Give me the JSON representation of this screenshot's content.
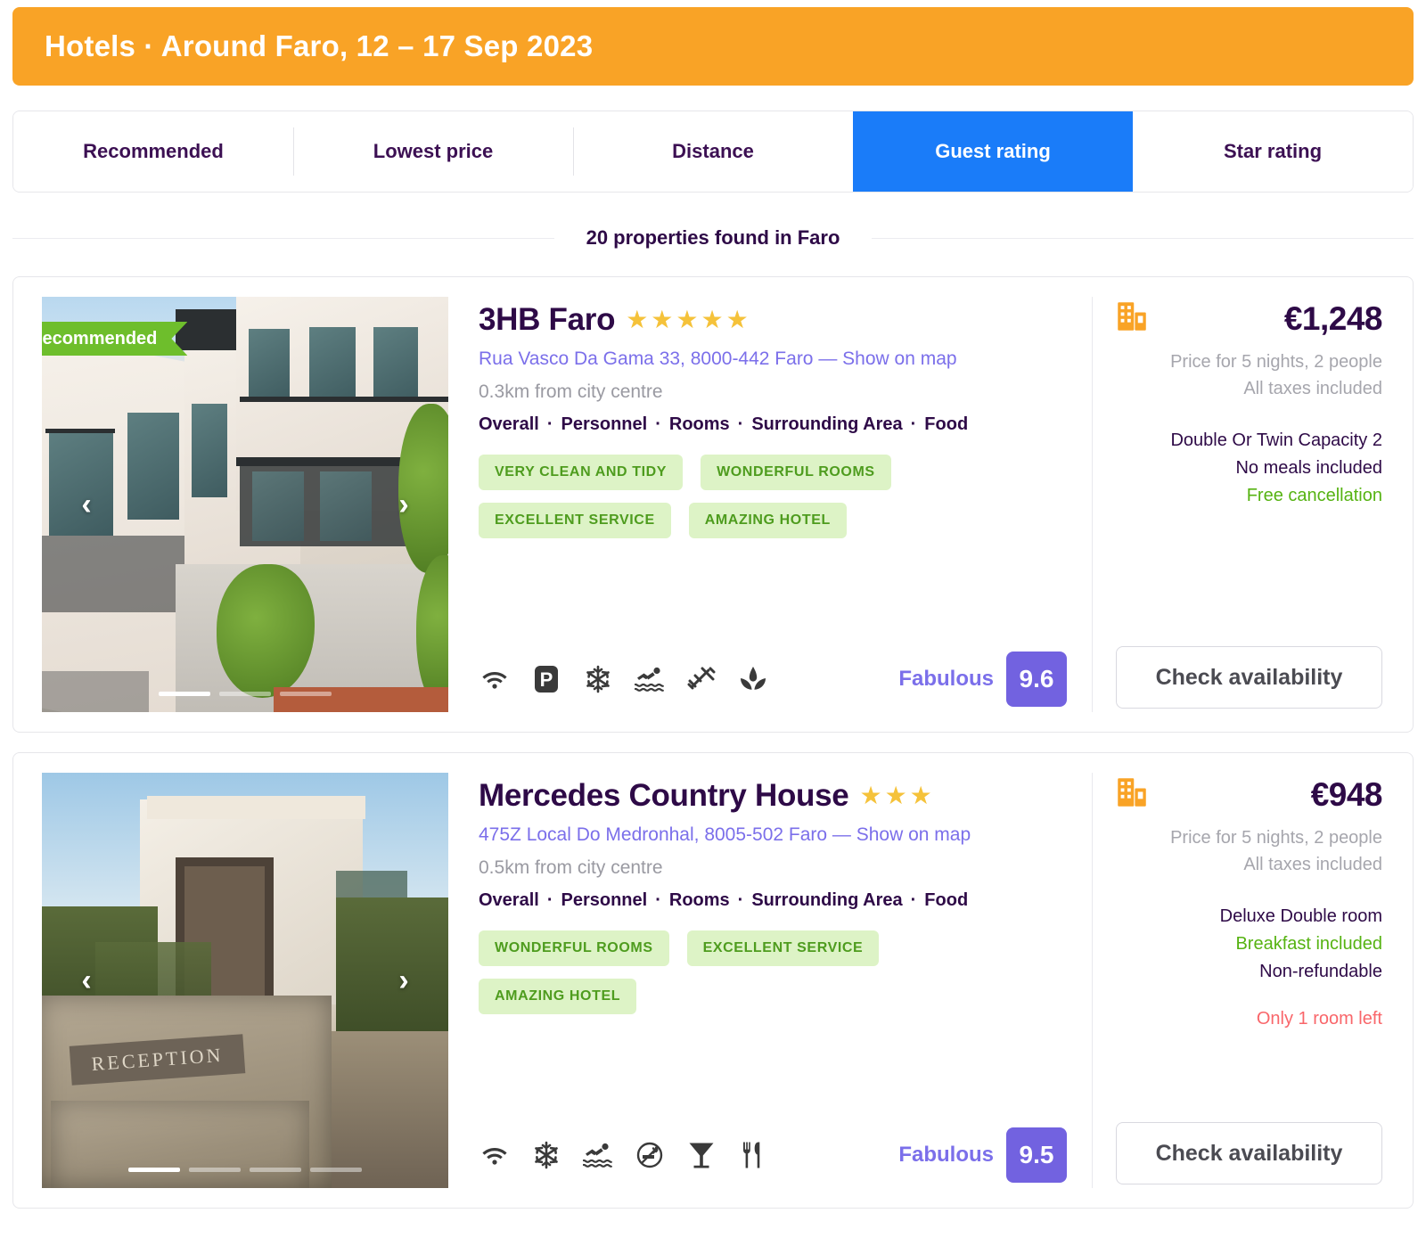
{
  "header": {
    "title": "Hotels · Around Faro, 12 – 17 Sep 2023",
    "accent_color": "#F9A326"
  },
  "sort_tabs": {
    "active_index": 3,
    "items": [
      {
        "label": "Recommended"
      },
      {
        "label": "Lowest price"
      },
      {
        "label": "Distance"
      },
      {
        "label": "Guest rating"
      },
      {
        "label": "Star rating"
      }
    ],
    "active_color": "#1A7CF9"
  },
  "results": {
    "count_text": "20 properties found in Faro"
  },
  "criteria_labels": {
    "overall": "Overall",
    "personnel": "Personnel",
    "rooms": "Rooms",
    "surrounding_area": "Surrounding Area",
    "food": "Food",
    "separator": "·"
  },
  "common": {
    "check_availability": "Check availability",
    "show_on_map": "Show on map",
    "price_note_line1": "Price for 5 nights, 2 people",
    "price_note_line2": "All taxes included",
    "prev_arrow": "‹",
    "next_arrow": "›"
  },
  "hotels": [
    {
      "badge": "Recommended",
      "name": "3HB Faro",
      "stars": 5,
      "address": "Rua Vasco Da Gama 33, 8000-442 Faro — Show on map",
      "distance": "0.3km from city centre",
      "tags": [
        "VERY CLEAN AND TIDY",
        "WONDERFUL ROOMS",
        "EXCELLENT SERVICE",
        "AMAZING HOTEL"
      ],
      "amenities": [
        "wifi-icon",
        "parking-icon",
        "air-conditioning-icon",
        "swimming-pool-icon",
        "gym-icon",
        "spa-icon"
      ],
      "rating_word": "Fabulous",
      "rating_score": "9.6",
      "price": "€1,248",
      "price_note_1": "Price for 5 nights, 2 people",
      "price_note_2": "All taxes included",
      "room_type": "Double Or Twin Capacity 2",
      "meals": "No meals included",
      "meals_highlight": false,
      "cancellation": "Free cancellation",
      "cancellation_highlight": true,
      "warning": "",
      "check_button": "Check availability",
      "carousel_slides": 3,
      "carousel_active": 0
    },
    {
      "badge": "",
      "name": "Mercedes Country House",
      "stars": 3,
      "address": "475Z Local Do Medronhal, 8005-502 Faro — Show on map",
      "distance": "0.5km from city centre",
      "tags": [
        "WONDERFUL ROOMS",
        "EXCELLENT SERVICE",
        "AMAZING HOTEL"
      ],
      "amenities": [
        "wifi-icon",
        "air-conditioning-icon",
        "swimming-pool-icon",
        "no-smoking-icon",
        "bar-icon",
        "restaurant-icon"
      ],
      "rating_word": "Fabulous",
      "rating_score": "9.5",
      "price": "€948",
      "price_note_1": "Price for 5 nights, 2 people",
      "price_note_2": "All taxes included",
      "room_type": "Deluxe Double room",
      "meals": "Breakfast included",
      "meals_highlight": true,
      "cancellation": "Non-refundable",
      "cancellation_highlight": false,
      "warning": "Only 1 room left",
      "check_button": "Check availability",
      "carousel_slides": 4,
      "carousel_active": 0
    }
  ],
  "colors": {
    "orange": "#F9A326",
    "blue": "#1A7CF9",
    "purple": "#7262E0",
    "green": "#56B312",
    "tag_green_bg": "#DDF3C6",
    "tag_green_fg": "#4E9C1E",
    "red": "#F9666A",
    "star_yellow": "#F5C23A",
    "ribbon_green": "#6EBE2C"
  }
}
